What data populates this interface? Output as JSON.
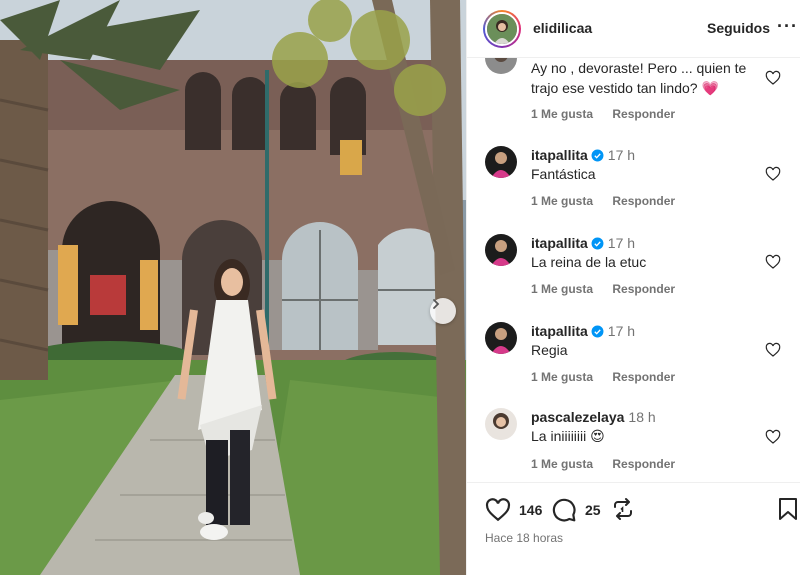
{
  "post": {
    "username": "elidilicaa",
    "follow_status": "Seguidos",
    "more_label": "···",
    "colors": {
      "accent_heart": "#ed4956",
      "verified": "#0095f6",
      "muted": "#737373"
    }
  },
  "comments": [
    {
      "username": "",
      "verified": false,
      "time": "",
      "text": "Ay no , devoraste! Pero ... quien te trajo ese vestido tan lindo? ",
      "emoji": "💗",
      "likes_label": "1 Me gusta",
      "reply_label": "Responder"
    },
    {
      "username": "itapallita",
      "verified": true,
      "time": "17 h",
      "text": "Fantástica",
      "emoji": "",
      "likes_label": "1 Me gusta",
      "reply_label": "Responder"
    },
    {
      "username": "itapallita",
      "verified": true,
      "time": "17 h",
      "text": "La reina de la etuc",
      "emoji": "",
      "likes_label": "1 Me gusta",
      "reply_label": "Responder"
    },
    {
      "username": "itapallita",
      "verified": true,
      "time": "17 h",
      "text": "Regia",
      "emoji": "",
      "likes_label": "1 Me gusta",
      "reply_label": "Responder"
    },
    {
      "username": "pascalezelaya",
      "verified": false,
      "time": "18 h",
      "text": "La iniiiiiiii ",
      "emoji": "😍",
      "likes_label": "1 Me gusta",
      "reply_label": "Responder"
    }
  ],
  "actions": {
    "likes_count": "146",
    "comments_count": "25",
    "posted_ago": "Hace 18 horas"
  },
  "icons": [
    "heart-icon",
    "comment-icon",
    "repost-icon",
    "bookmark-icon",
    "verified-badge-icon",
    "chevron-right-icon",
    "more-options-icon"
  ]
}
